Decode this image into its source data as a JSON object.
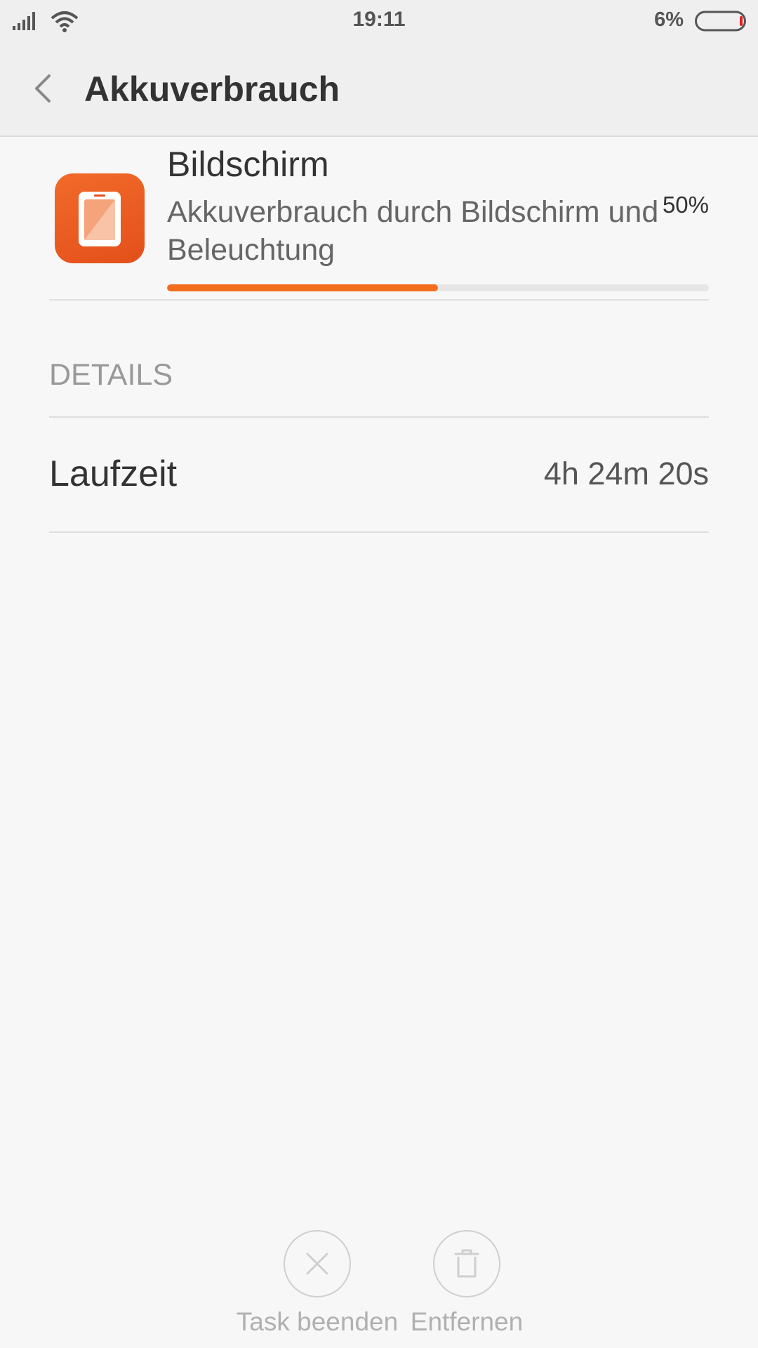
{
  "status_bar": {
    "time": "19:11",
    "battery_percent": "6%"
  },
  "header": {
    "title": "Akkuverbrauch"
  },
  "usage_item": {
    "title": "Bildschirm",
    "subtitle": "Akkuverbrauch durch Bildschirm und Beleuchtung",
    "percent": "50%",
    "progress_fraction": 0.5,
    "accent_color": "#f26d1e",
    "icon": "screen-icon"
  },
  "details": {
    "section_label": "DETAILS",
    "runtime_label": "Laufzeit",
    "runtime_value": "4h 24m 20s"
  },
  "actions": {
    "kill_label": "Task beenden",
    "kill_icon": "close-icon",
    "remove_label": "Entfernen",
    "remove_icon": "trash-icon"
  }
}
